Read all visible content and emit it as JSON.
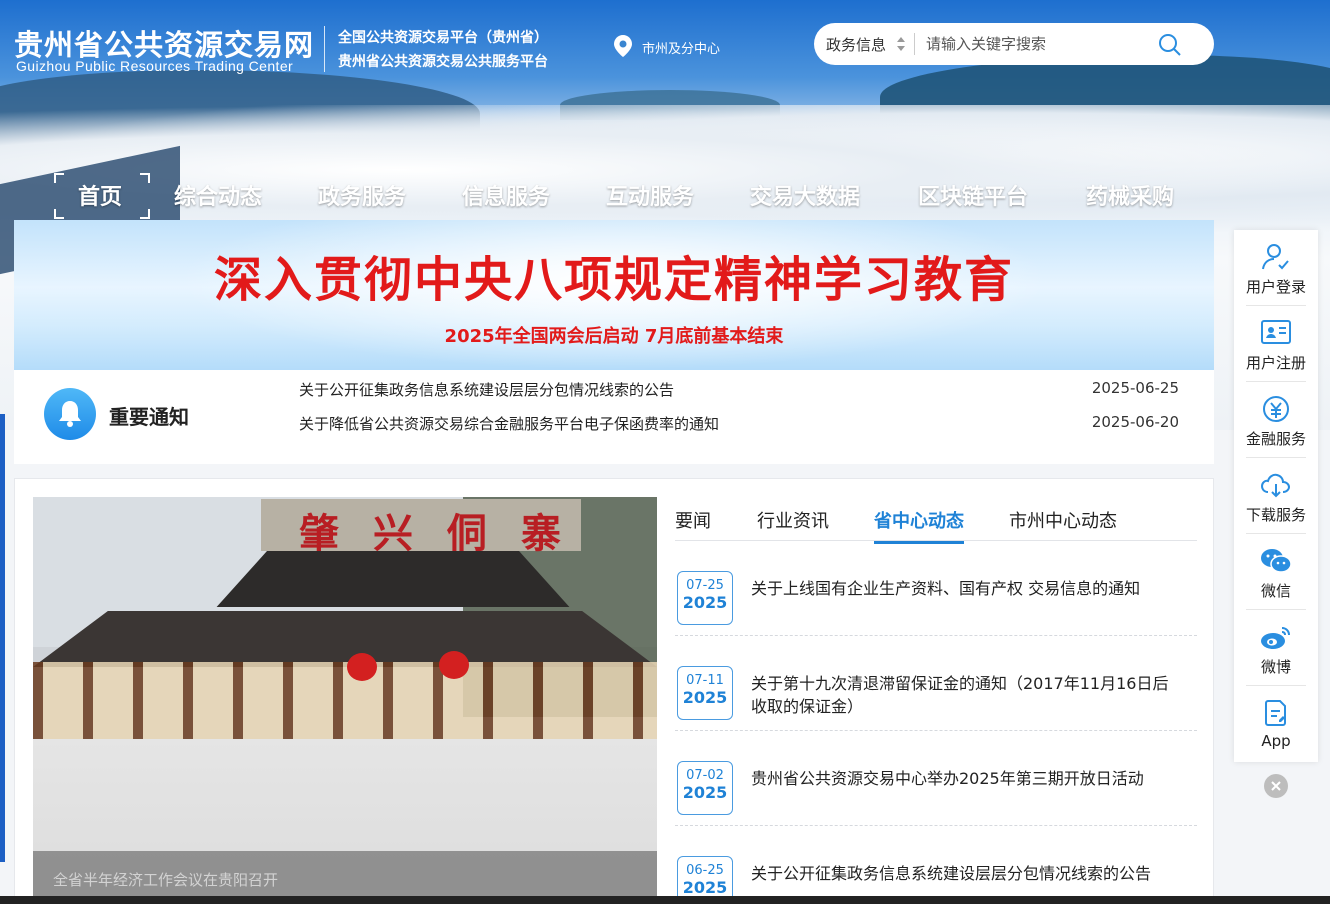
{
  "header": {
    "site_title": "贵州省公共资源交易网",
    "site_title_en": "Guizhou Public Resources Trading Center",
    "platform_line1": "全国公共资源交易平台（贵州省）",
    "platform_line2": "贵州省公共资源交易公共服务平台",
    "location_link": "市州及分中心"
  },
  "search": {
    "type_selected": "政务信息",
    "placeholder": "请输入关键字搜索"
  },
  "nav": {
    "items": [
      "首页",
      "综合动态",
      "政务服务",
      "信息服务",
      "互动服务",
      "交易大数据",
      "区块链平台",
      "药械采购"
    ],
    "active": "首页"
  },
  "banner": {
    "title": "深入贯彻中央八项规定精神学习教育",
    "subtitle": "2025年全国两会后启动  7月底前基本结束"
  },
  "notice": {
    "heading": "重要通知",
    "items": [
      {
        "title": "关于公开征集政务信息系统建设层层分包情况线索的公告",
        "date": "2025-06-25"
      },
      {
        "title": "关于降低省公共资源交易综合金融服务平台电子保函费率的通知",
        "date": "2025-06-20"
      }
    ]
  },
  "photo": {
    "sign_chars": [
      "肇",
      "兴",
      "侗",
      "寨"
    ],
    "caption": "全省半年经济工作会议在贵阳召开"
  },
  "tabs": [
    "要闻",
    "行业资讯",
    "省中心动态",
    "市州中心动态"
  ],
  "active_tab": "省中心动态",
  "news": [
    {
      "md": "07-25",
      "year": "2025",
      "title": "关于上线国有企业生产资料、国有产权 交易信息的通知"
    },
    {
      "md": "07-11",
      "year": "2025",
      "title": "关于第十九次清退滞留保证金的通知（2017年11月16日后收取的保证金）"
    },
    {
      "md": "07-02",
      "year": "2025",
      "title": "贵州省公共资源交易中心举办2025年第三期开放日活动"
    },
    {
      "md": "06-25",
      "year": "2025",
      "title": "关于公开征集政务信息系统建设层层分包情况线索的公告"
    }
  ],
  "sidebar": {
    "items": [
      {
        "label": "用户登录",
        "icon": "user-login-icon"
      },
      {
        "label": "用户注册",
        "icon": "user-register-icon"
      },
      {
        "label": "金融服务",
        "icon": "finance-icon"
      },
      {
        "label": "下载服务",
        "icon": "cloud-download-icon"
      },
      {
        "label": "微信",
        "icon": "wechat-icon"
      },
      {
        "label": "微博",
        "icon": "weibo-icon"
      },
      {
        "label": "App",
        "icon": "app-icon"
      }
    ]
  },
  "colors": {
    "accent": "#1f82d6",
    "banner_red": "#e21a1a",
    "nav_text": "#ffffff"
  }
}
